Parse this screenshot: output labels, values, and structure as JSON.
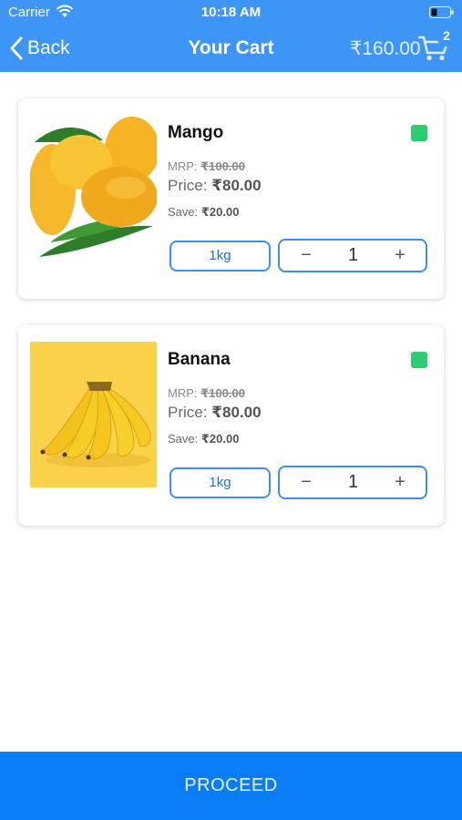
{
  "status_bar": {
    "carrier": "Carrier",
    "time": "10:18 AM"
  },
  "nav": {
    "back_label": "Back",
    "title": "Your Cart",
    "cart_total": "₹160.00",
    "cart_count": "2"
  },
  "items": [
    {
      "name": "Mango",
      "mrp_label": "MRP: ",
      "mrp": "₹100.00",
      "price_label": "Price: ",
      "price": "₹80.00",
      "save_label": "Save: ",
      "save": "₹20.00",
      "unit": "1kg",
      "quantity": "1",
      "minus": "−",
      "plus": "+",
      "in_stock_color": "#2ecc71"
    },
    {
      "name": "Banana",
      "mrp_label": "MRP: ",
      "mrp": "₹100.00",
      "price_label": "Price: ",
      "price": "₹80.00",
      "save_label": "Save: ",
      "save": "₹20.00",
      "unit": "1kg",
      "quantity": "1",
      "minus": "−",
      "plus": "+",
      "in_stock_color": "#2ecc71"
    }
  ],
  "footer": {
    "proceed_label": "PROCEED"
  },
  "colors": {
    "header": "#3d96f5",
    "proceed": "#0a7cf6",
    "accent": "#3d8ef0"
  }
}
